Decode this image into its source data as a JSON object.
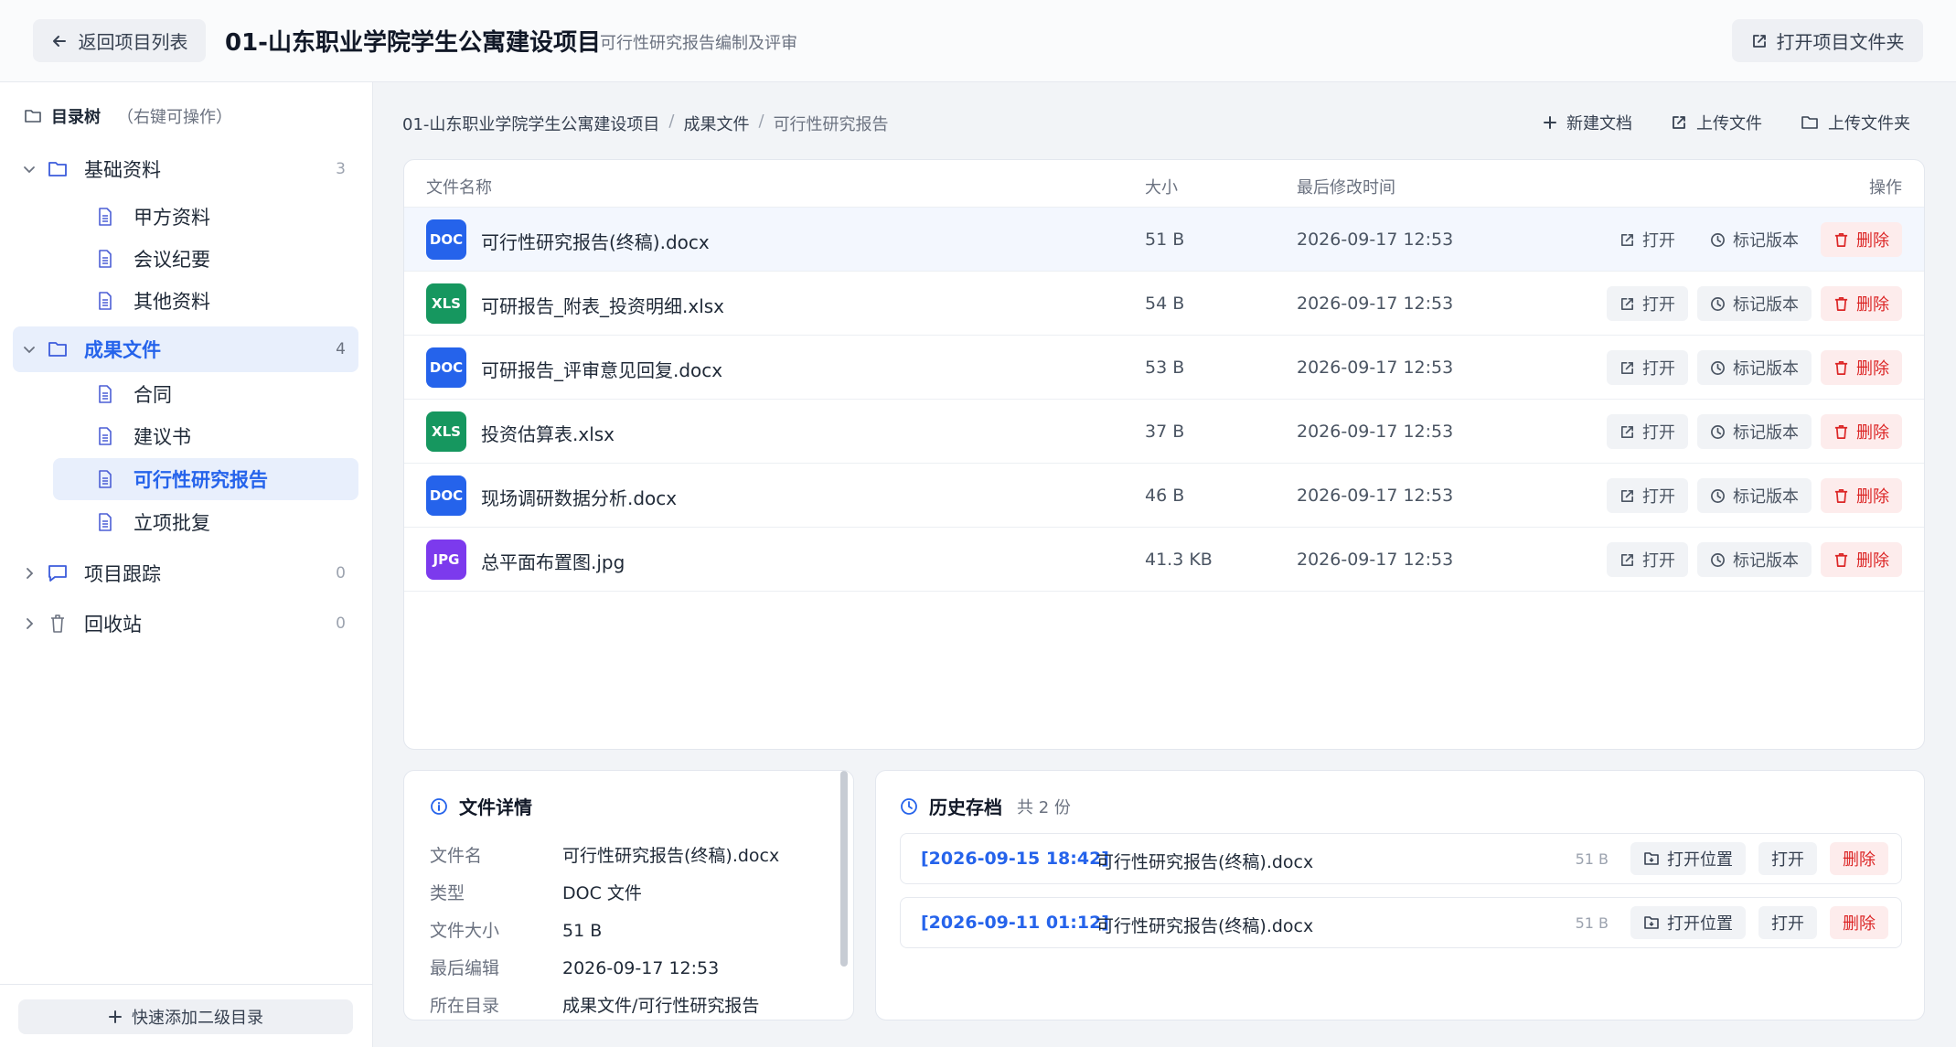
{
  "header": {
    "back_label": "返回项目列表",
    "project_title": "01-山东职业学院学生公寓建设项目",
    "subtitle": "可行性研究报告编制及评审",
    "open_folder_label": "打开项目文件夹"
  },
  "sidebar": {
    "tree_title": "目录树",
    "tree_hint": "（右键可操作）",
    "groups": [
      {
        "label": "基础资料",
        "count": "3",
        "children": [
          "甲方资料",
          "会议纪要",
          "其他资料"
        ]
      },
      {
        "label": "成果文件",
        "count": "4",
        "children": [
          "合同",
          "建议书",
          "可行性研究报告",
          "立项批复"
        ]
      },
      {
        "label": "项目跟踪",
        "count": "0"
      },
      {
        "label": "回收站",
        "count": "0"
      }
    ],
    "quick_add_label": "快速添加二级目录"
  },
  "breadcrumb": [
    "01-山东职业学院学生公寓建设项目",
    "成果文件",
    "可行性研究报告"
  ],
  "breadcrumb_sep": "/",
  "toolbar": {
    "new_doc": "新建文档",
    "upload_file": "上传文件",
    "upload_folder": "上传文件夹"
  },
  "table": {
    "headers": [
      "文件名称",
      "大小",
      "最后修改时间",
      "操作"
    ],
    "rows": [
      {
        "badge": "DOC",
        "name": "可行性研究报告(终稿).docx",
        "size": "51 B",
        "modified": "2026-09-17 12:53"
      },
      {
        "badge": "XLS",
        "name": "可研报告_附表_投资明细.xlsx",
        "size": "54 B",
        "modified": "2026-09-17 12:53"
      },
      {
        "badge": "DOC",
        "name": "可研报告_评审意见回复.docx",
        "size": "53 B",
        "modified": "2026-09-17 12:53"
      },
      {
        "badge": "XLS",
        "name": "投资估算表.xlsx",
        "size": "37 B",
        "modified": "2026-09-17 12:53"
      },
      {
        "badge": "DOC",
        "name": "现场调研数据分析.docx",
        "size": "46 B",
        "modified": "2026-09-17 12:53"
      },
      {
        "badge": "JPG",
        "name": "总平面布置图.jpg",
        "size": "41.3 KB",
        "modified": "2026-09-17 12:53"
      }
    ],
    "action_labels": {
      "open": "打开",
      "mark": "标记版本",
      "delete": "删除"
    }
  },
  "badge_colors": {
    "DOC": "#2563eb",
    "XLS": "#16975f",
    "JPG": "#7c3aed"
  },
  "details": {
    "title": "文件详情",
    "fields": [
      {
        "key": "文件名",
        "value": "可行性研究报告(终稿).docx"
      },
      {
        "key": "类型",
        "value": "DOC 文件"
      },
      {
        "key": "文件大小",
        "value": "51 B"
      },
      {
        "key": "最后编辑",
        "value": "2026-09-17 12:53"
      },
      {
        "key": "所在目录",
        "value": "成果文件/可行性研究报告"
      }
    ]
  },
  "history": {
    "title": "历史存档",
    "count": "共 2 份",
    "items": [
      {
        "date": "[2026-09-15 18:42]",
        "name": "可行性研究报告(终稿).docx",
        "size": "51 B"
      },
      {
        "date": "[2026-09-11 01:12]",
        "name": "可行性研究报告(终稿).docx",
        "size": "51 B"
      }
    ],
    "action_labels": {
      "open_location": "打开位置",
      "open": "打开",
      "delete": "删除"
    }
  },
  "colors": {
    "accent": "#2563eb",
    "danger": "#dc2626",
    "folder_icon": "#3b5bdb",
    "doc_icon": "#4c5fd5"
  }
}
